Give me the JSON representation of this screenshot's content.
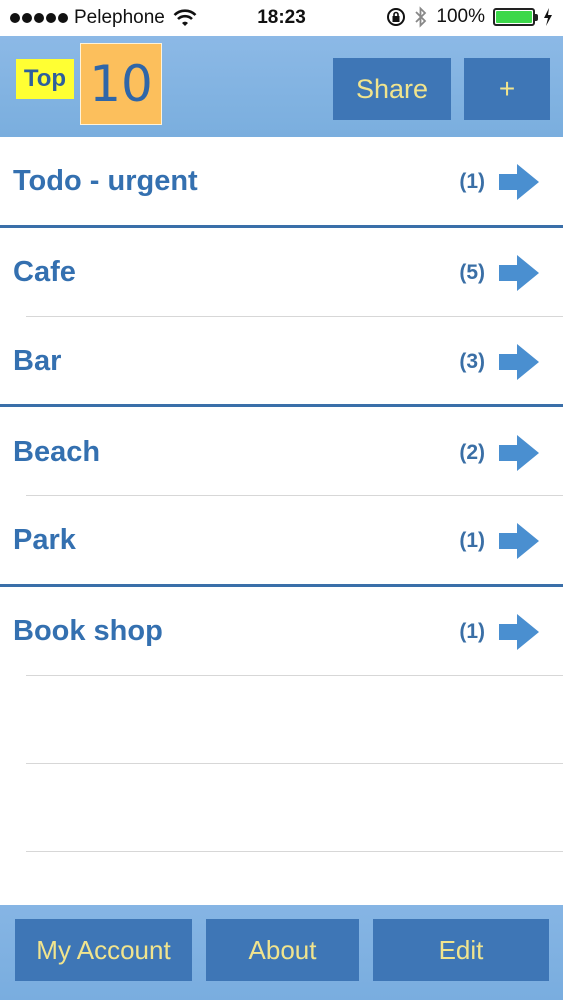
{
  "status_bar": {
    "carrier": "Pelephone",
    "time": "18:23",
    "battery": "100%",
    "battery_level": 1.0
  },
  "header": {
    "logo_top": "Top",
    "logo_number": "10",
    "share_label": "Share",
    "add_label": "+"
  },
  "list": {
    "items": [
      {
        "name": "Todo - urgent",
        "count": "(1)"
      },
      {
        "name": "Cafe",
        "count": "(5)"
      },
      {
        "name": "Bar",
        "count": "(3)"
      },
      {
        "name": "Beach",
        "count": "(2)"
      },
      {
        "name": "Park",
        "count": "(1)"
      },
      {
        "name": "Book shop",
        "count": "(1)"
      }
    ]
  },
  "toolbar": {
    "my_account_label": "My Account",
    "about_label": "About",
    "edit_label": "Edit"
  },
  "colors": {
    "accent": "#3e76b6",
    "button_text": "#f1e48d",
    "item_text": "#3470b0",
    "arrow": "#4a8fd0",
    "logo_top_bg": "#ffff33",
    "logo_ten_bg": "#fcbf5c"
  },
  "icons": {
    "signal": "signal-dots-icon",
    "wifi": "wifi-icon",
    "lock": "rotation-lock-icon",
    "bluetooth": "bluetooth-icon",
    "battery": "battery-icon",
    "charging": "charging-bolt-icon",
    "arrow": "arrow-right-icon"
  }
}
